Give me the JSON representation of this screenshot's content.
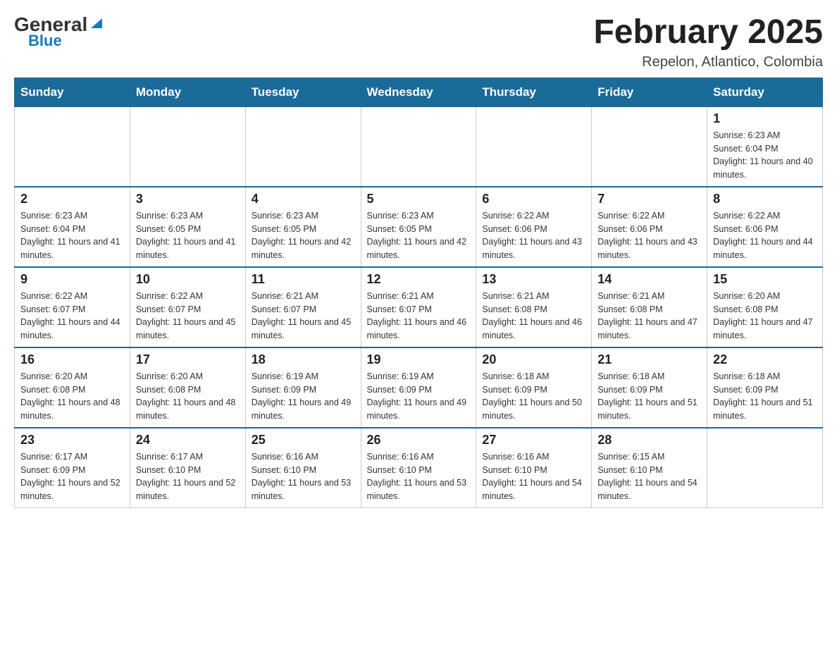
{
  "header": {
    "logo_general": "General",
    "logo_blue": "Blue",
    "title": "February 2025",
    "subtitle": "Repelon, Atlantico, Colombia"
  },
  "days_of_week": [
    "Sunday",
    "Monday",
    "Tuesday",
    "Wednesday",
    "Thursday",
    "Friday",
    "Saturday"
  ],
  "weeks": [
    [
      {
        "day": "",
        "sunrise": "",
        "sunset": "",
        "daylight": ""
      },
      {
        "day": "",
        "sunrise": "",
        "sunset": "",
        "daylight": ""
      },
      {
        "day": "",
        "sunrise": "",
        "sunset": "",
        "daylight": ""
      },
      {
        "day": "",
        "sunrise": "",
        "sunset": "",
        "daylight": ""
      },
      {
        "day": "",
        "sunrise": "",
        "sunset": "",
        "daylight": ""
      },
      {
        "day": "",
        "sunrise": "",
        "sunset": "",
        "daylight": ""
      },
      {
        "day": "1",
        "sunrise": "Sunrise: 6:23 AM",
        "sunset": "Sunset: 6:04 PM",
        "daylight": "Daylight: 11 hours and 40 minutes."
      }
    ],
    [
      {
        "day": "2",
        "sunrise": "Sunrise: 6:23 AM",
        "sunset": "Sunset: 6:04 PM",
        "daylight": "Daylight: 11 hours and 41 minutes."
      },
      {
        "day": "3",
        "sunrise": "Sunrise: 6:23 AM",
        "sunset": "Sunset: 6:05 PM",
        "daylight": "Daylight: 11 hours and 41 minutes."
      },
      {
        "day": "4",
        "sunrise": "Sunrise: 6:23 AM",
        "sunset": "Sunset: 6:05 PM",
        "daylight": "Daylight: 11 hours and 42 minutes."
      },
      {
        "day": "5",
        "sunrise": "Sunrise: 6:23 AM",
        "sunset": "Sunset: 6:05 PM",
        "daylight": "Daylight: 11 hours and 42 minutes."
      },
      {
        "day": "6",
        "sunrise": "Sunrise: 6:22 AM",
        "sunset": "Sunset: 6:06 PM",
        "daylight": "Daylight: 11 hours and 43 minutes."
      },
      {
        "day": "7",
        "sunrise": "Sunrise: 6:22 AM",
        "sunset": "Sunset: 6:06 PM",
        "daylight": "Daylight: 11 hours and 43 minutes."
      },
      {
        "day": "8",
        "sunrise": "Sunrise: 6:22 AM",
        "sunset": "Sunset: 6:06 PM",
        "daylight": "Daylight: 11 hours and 44 minutes."
      }
    ],
    [
      {
        "day": "9",
        "sunrise": "Sunrise: 6:22 AM",
        "sunset": "Sunset: 6:07 PM",
        "daylight": "Daylight: 11 hours and 44 minutes."
      },
      {
        "day": "10",
        "sunrise": "Sunrise: 6:22 AM",
        "sunset": "Sunset: 6:07 PM",
        "daylight": "Daylight: 11 hours and 45 minutes."
      },
      {
        "day": "11",
        "sunrise": "Sunrise: 6:21 AM",
        "sunset": "Sunset: 6:07 PM",
        "daylight": "Daylight: 11 hours and 45 minutes."
      },
      {
        "day": "12",
        "sunrise": "Sunrise: 6:21 AM",
        "sunset": "Sunset: 6:07 PM",
        "daylight": "Daylight: 11 hours and 46 minutes."
      },
      {
        "day": "13",
        "sunrise": "Sunrise: 6:21 AM",
        "sunset": "Sunset: 6:08 PM",
        "daylight": "Daylight: 11 hours and 46 minutes."
      },
      {
        "day": "14",
        "sunrise": "Sunrise: 6:21 AM",
        "sunset": "Sunset: 6:08 PM",
        "daylight": "Daylight: 11 hours and 47 minutes."
      },
      {
        "day": "15",
        "sunrise": "Sunrise: 6:20 AM",
        "sunset": "Sunset: 6:08 PM",
        "daylight": "Daylight: 11 hours and 47 minutes."
      }
    ],
    [
      {
        "day": "16",
        "sunrise": "Sunrise: 6:20 AM",
        "sunset": "Sunset: 6:08 PM",
        "daylight": "Daylight: 11 hours and 48 minutes."
      },
      {
        "day": "17",
        "sunrise": "Sunrise: 6:20 AM",
        "sunset": "Sunset: 6:08 PM",
        "daylight": "Daylight: 11 hours and 48 minutes."
      },
      {
        "day": "18",
        "sunrise": "Sunrise: 6:19 AM",
        "sunset": "Sunset: 6:09 PM",
        "daylight": "Daylight: 11 hours and 49 minutes."
      },
      {
        "day": "19",
        "sunrise": "Sunrise: 6:19 AM",
        "sunset": "Sunset: 6:09 PM",
        "daylight": "Daylight: 11 hours and 49 minutes."
      },
      {
        "day": "20",
        "sunrise": "Sunrise: 6:18 AM",
        "sunset": "Sunset: 6:09 PM",
        "daylight": "Daylight: 11 hours and 50 minutes."
      },
      {
        "day": "21",
        "sunrise": "Sunrise: 6:18 AM",
        "sunset": "Sunset: 6:09 PM",
        "daylight": "Daylight: 11 hours and 51 minutes."
      },
      {
        "day": "22",
        "sunrise": "Sunrise: 6:18 AM",
        "sunset": "Sunset: 6:09 PM",
        "daylight": "Daylight: 11 hours and 51 minutes."
      }
    ],
    [
      {
        "day": "23",
        "sunrise": "Sunrise: 6:17 AM",
        "sunset": "Sunset: 6:09 PM",
        "daylight": "Daylight: 11 hours and 52 minutes."
      },
      {
        "day": "24",
        "sunrise": "Sunrise: 6:17 AM",
        "sunset": "Sunset: 6:10 PM",
        "daylight": "Daylight: 11 hours and 52 minutes."
      },
      {
        "day": "25",
        "sunrise": "Sunrise: 6:16 AM",
        "sunset": "Sunset: 6:10 PM",
        "daylight": "Daylight: 11 hours and 53 minutes."
      },
      {
        "day": "26",
        "sunrise": "Sunrise: 6:16 AM",
        "sunset": "Sunset: 6:10 PM",
        "daylight": "Daylight: 11 hours and 53 minutes."
      },
      {
        "day": "27",
        "sunrise": "Sunrise: 6:16 AM",
        "sunset": "Sunset: 6:10 PM",
        "daylight": "Daylight: 11 hours and 54 minutes."
      },
      {
        "day": "28",
        "sunrise": "Sunrise: 6:15 AM",
        "sunset": "Sunset: 6:10 PM",
        "daylight": "Daylight: 11 hours and 54 minutes."
      },
      {
        "day": "",
        "sunrise": "",
        "sunset": "",
        "daylight": ""
      }
    ]
  ]
}
